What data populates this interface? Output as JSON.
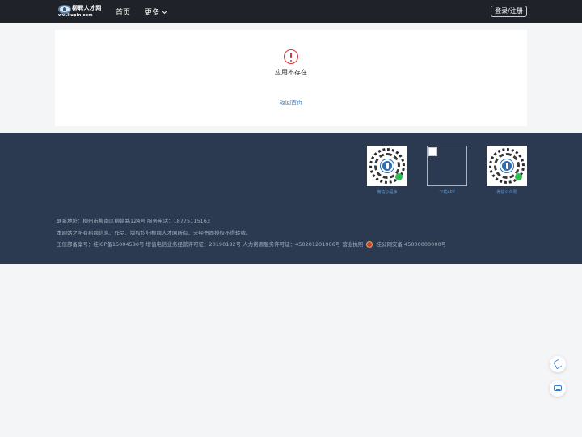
{
  "header": {
    "logo_cn": "柳聘人才网",
    "logo_en": "ww.liupin.com",
    "nav_home": "首页",
    "nav_more": "更多",
    "login_label": "登录/注册"
  },
  "error": {
    "icon": "exclamation-circle-icon",
    "message": "应用不存在",
    "back_link": "返回首页"
  },
  "footer": {
    "qr_codes": [
      {
        "label": "微信小程序"
      },
      {
        "label": "下载APP"
      },
      {
        "label": "微信公众号"
      }
    ],
    "address_line": "联系地址：柳州市柳南区柳邕路124号   服务电话：18775115163",
    "copyright_line": "本网站之所有招聘信息、作品、版权均归柳聘人才网所有，未经书面授权不得转载。",
    "license_prefix": "工信部备案号：桂ICP备15004580号   增值电信业务经营许可证：20190182号   人力资源服务许可证：450201201906号   营业执照",
    "police_label": "桂公网安备 45000000000号"
  },
  "side_tools": {
    "phone_icon": "phone-icon",
    "chat_icon": "chat-icon"
  },
  "colors": {
    "topbar": "#1f2329",
    "footer": "#2b3a51",
    "accent": "#2f7fd7",
    "error": "#d9363e"
  }
}
